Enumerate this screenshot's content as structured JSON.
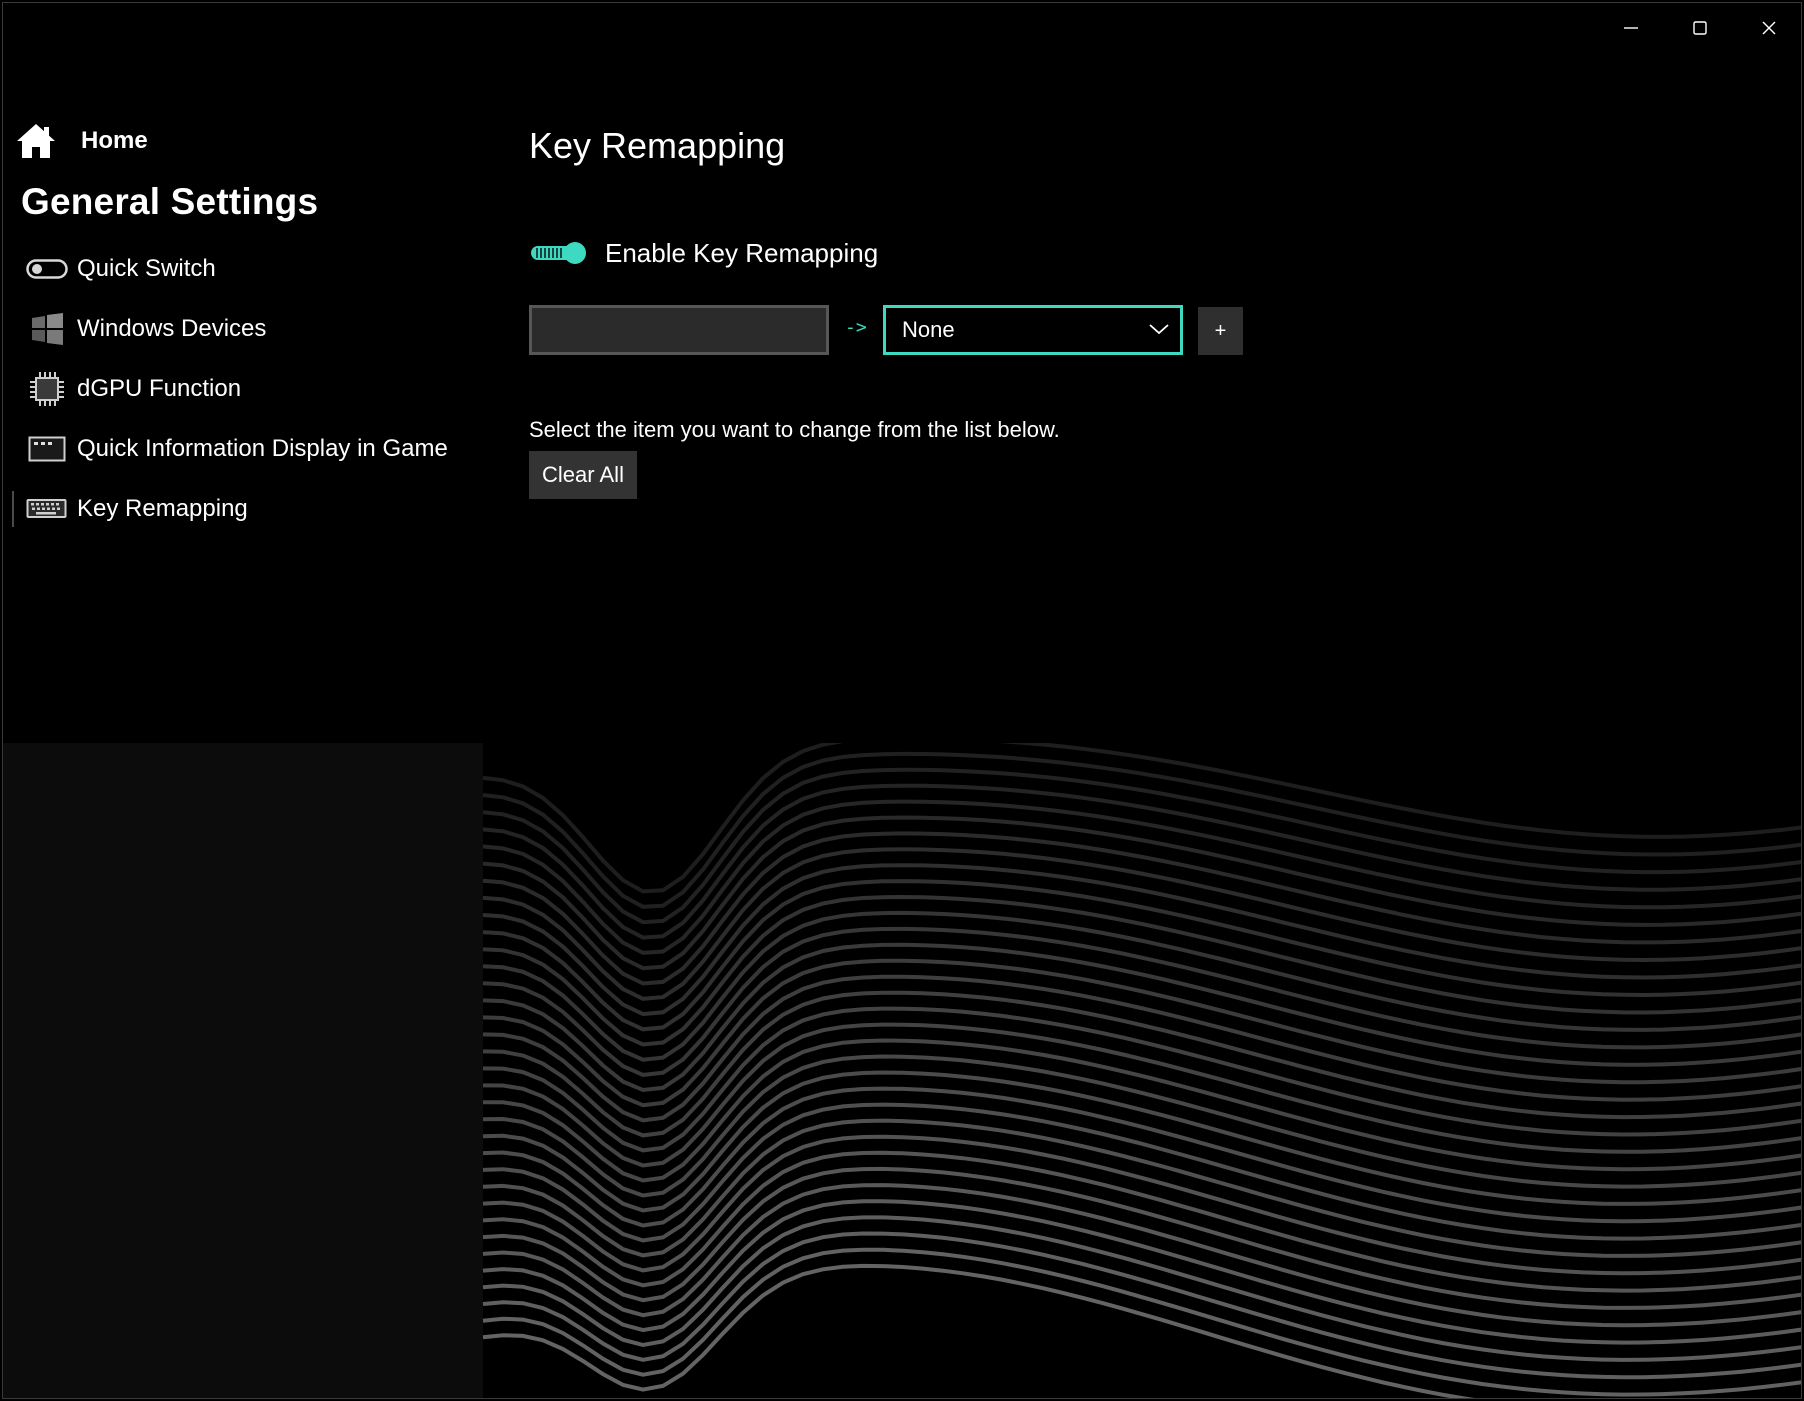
{
  "window": {
    "controls": {
      "minimize": "minimize",
      "maximize": "maximize",
      "close": "close"
    }
  },
  "sidebar": {
    "home_label": "Home",
    "section_title": "General Settings",
    "items": [
      {
        "label": "Quick Switch",
        "icon": "toggle-icon"
      },
      {
        "label": "Windows Devices",
        "icon": "windows-icon"
      },
      {
        "label": "dGPU Function",
        "icon": "chip-icon"
      },
      {
        "label": "Quick Information Display in Game",
        "icon": "display-icon"
      },
      {
        "label": "Key Remapping",
        "icon": "keyboard-icon",
        "active": true
      }
    ]
  },
  "main": {
    "title": "Key Remapping",
    "toggle": {
      "label": "Enable Key Remapping",
      "on": true
    },
    "remap": {
      "source_value": "",
      "arrow": "->",
      "target_value": "None",
      "add_label": "+"
    },
    "instruction": "Select the item you want to change from the list below.",
    "clear_all_label": "Clear All"
  },
  "colors": {
    "accent": "#3dd9c1",
    "background": "#000000",
    "input_bg": "#2b2b2b",
    "button_bg": "#333333"
  }
}
